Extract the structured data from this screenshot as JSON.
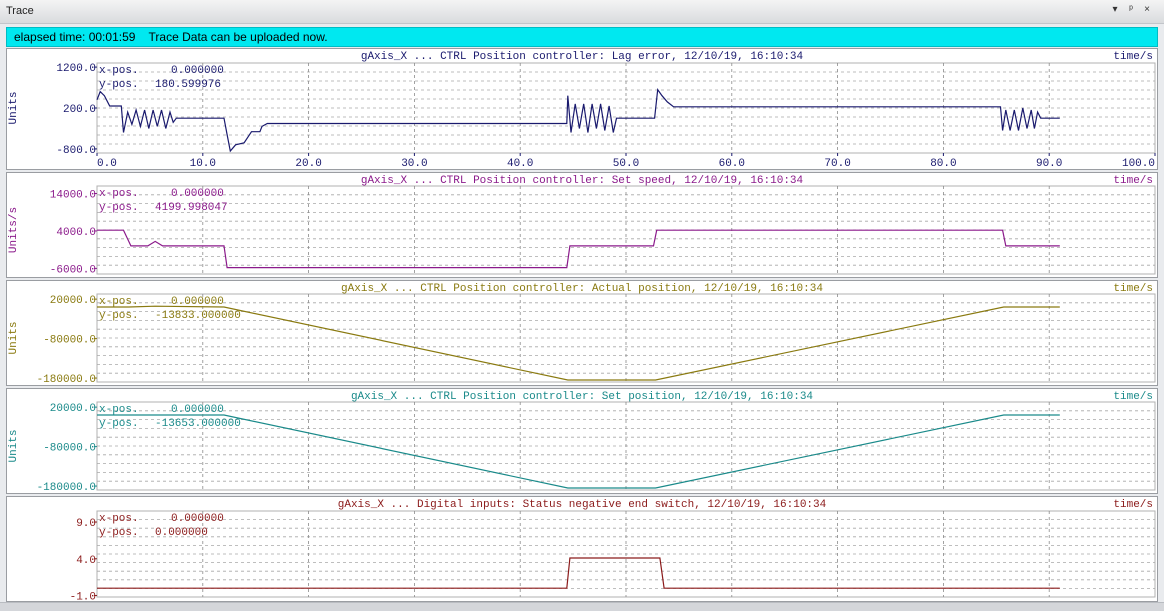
{
  "window": {
    "title": "Trace",
    "controls": {
      "menu": "▾",
      "pin": "ᵖ",
      "close": "×"
    }
  },
  "status": {
    "elapsed_label": "elapsed time: 00:01:59",
    "message": "Trace Data can be uploaded now."
  },
  "colors": {
    "status_bg": "#00e8f0",
    "grid": "#9a9a9a"
  },
  "chart_data": [
    {
      "type": "line",
      "title": "gAxis_X ... CTRL Position controller: Lag error, 12/10/19, 16:10:34",
      "unit_label": "time/s",
      "ylabel": "Units",
      "color": "#1a1a6e",
      "ylim": [
        -900,
        1300
      ],
      "yticks": [
        1200,
        200,
        -800
      ],
      "ytick_labels": [
        "1200.0",
        "200.0",
        "-800.0"
      ],
      "show_xticks": true,
      "xticks": [
        0,
        10,
        20,
        30,
        40,
        50,
        60,
        70,
        80,
        90,
        100
      ],
      "xtick_labels": [
        "0.0",
        "10.0",
        "20.0",
        "30.0",
        "40.0",
        "50.0",
        "60.0",
        "70.0",
        "80.0",
        "90.0",
        "100.0"
      ],
      "cursor": {
        "x_label": "x-pos.",
        "x_value": "0.000000",
        "y_label": "y-pos.",
        "y_value": "180.599976"
      },
      "x": [
        0,
        0.3,
        0.7,
        1.2,
        2.3,
        2.5,
        2.9,
        3.3,
        3.7,
        4.1,
        4.5,
        4.9,
        5.3,
        5.7,
        6.1,
        6.5,
        6.9,
        7.2,
        7.5,
        12,
        12.3,
        12.6,
        13.1,
        13.9,
        14.6,
        15.4,
        15.6,
        16.1,
        16.6,
        44.4,
        44.5,
        44.8,
        45.2,
        45.6,
        46,
        46.4,
        46.8,
        47.2,
        47.6,
        48,
        48.4,
        48.8,
        49.1,
        52.7,
        53,
        53.4,
        53.9,
        54.5,
        55,
        85.4,
        85.6,
        85.9,
        86.3,
        86.7,
        87.1,
        87.5,
        87.9,
        88.3,
        88.6,
        88.9,
        89.2,
        91
      ],
      "y": [
        400,
        600,
        500,
        250,
        250,
        -400,
        100,
        -200,
        150,
        -250,
        150,
        -300,
        150,
        -250,
        150,
        -300,
        100,
        -150,
        -50,
        -50,
        -450,
        -850,
        -700,
        -650,
        -380,
        -380,
        -250,
        -180,
        -180,
        -180,
        500,
        -400,
        300,
        -300,
        300,
        -400,
        300,
        -300,
        300,
        -350,
        250,
        -400,
        -50,
        -50,
        650,
        500,
        350,
        230,
        230,
        230,
        -350,
        150,
        -350,
        150,
        -350,
        200,
        -300,
        150,
        -300,
        100,
        -50,
        -50
      ]
    },
    {
      "type": "line",
      "title": "gAxis_X ... CTRL Position controller: Set speed, 12/10/19, 16:10:34",
      "unit_label": "time/s",
      "ylabel": "Units/s",
      "color": "#8b1a8b",
      "ylim": [
        -7500,
        16000
      ],
      "yticks": [
        14000,
        4000,
        -6000
      ],
      "ytick_labels": [
        "14000.0",
        "4000.0",
        "-6000.0"
      ],
      "show_xticks": false,
      "xticks": [
        0,
        10,
        20,
        30,
        40,
        50,
        60,
        70,
        80,
        90,
        100
      ],
      "cursor": {
        "x_label": "x-pos.",
        "x_value": "0.000000",
        "y_label": "y-pos.",
        "y_value": "4199.998047"
      },
      "x": [
        0,
        2.5,
        3.2,
        4.8,
        5.5,
        6.2,
        12,
        12.3,
        44.4,
        44.7,
        52.6,
        52.9,
        85.6,
        85.9,
        91
      ],
      "y": [
        4200,
        4200,
        0,
        0,
        1200,
        0,
        0,
        -5800,
        -5800,
        0,
        0,
        4200,
        4200,
        0,
        0
      ]
    },
    {
      "type": "line",
      "title": "gAxis_X ... CTRL Position controller: Actual position, 12/10/19, 16:10:34",
      "unit_label": "time/s",
      "ylabel": "Units",
      "color": "#8a7a10",
      "ylim": [
        -190000,
        33000
      ],
      "yticks": [
        20000,
        -80000,
        -180000
      ],
      "ytick_labels": [
        "20000.0",
        "-80000.0",
        "-180000.0"
      ],
      "show_xticks": false,
      "xticks": [
        0,
        10,
        20,
        30,
        40,
        50,
        60,
        70,
        80,
        90,
        100
      ],
      "cursor": {
        "x_label": "x-pos.",
        "x_value": "0.000000",
        "y_label": "y-pos.",
        "y_value": "-13833.000000"
      },
      "x": [
        0,
        3,
        5.5,
        12,
        44.5,
        52.8,
        85.7,
        91
      ],
      "y": [
        0,
        0,
        2000,
        0,
        -185000,
        -185000,
        0,
        0
      ]
    },
    {
      "type": "line",
      "title": "gAxis_X ... CTRL Position controller: Set position, 12/10/19, 16:10:34",
      "unit_label": "time/s",
      "ylabel": "Units",
      "color": "#1a8a8a",
      "ylim": [
        -190000,
        33000
      ],
      "yticks": [
        20000,
        -80000,
        -180000
      ],
      "ytick_labels": [
        "20000.0",
        "-80000.0",
        "-180000.0"
      ],
      "show_xticks": false,
      "xticks": [
        0,
        10,
        20,
        30,
        40,
        50,
        60,
        70,
        80,
        90,
        100
      ],
      "cursor": {
        "x_label": "x-pos.",
        "x_value": "0.000000",
        "y_label": "y-pos.",
        "y_value": "-13653.000000"
      },
      "x": [
        0,
        12,
        44.5,
        52.8,
        85.7,
        91
      ],
      "y": [
        0,
        0,
        -185000,
        -185000,
        0,
        0
      ]
    },
    {
      "type": "line",
      "title": "gAxis_X ... Digital inputs: Status negative end switch, 12/10/19, 16:10:34",
      "unit_label": "time/s",
      "ylabel": "",
      "color": "#8b1a1a",
      "ylim": [
        -1.2,
        10.5
      ],
      "yticks": [
        9,
        4,
        -1
      ],
      "ytick_labels": [
        "9.0",
        "4.0",
        "-1.0"
      ],
      "show_xticks": false,
      "xticks": [
        0,
        10,
        20,
        30,
        40,
        50,
        60,
        70,
        80,
        90,
        100
      ],
      "cursor": {
        "x_label": "x-pos.",
        "x_value": "0.000000",
        "y_label": "y-pos.",
        "y_value": "0.000000"
      },
      "x": [
        0,
        44.4,
        44.7,
        53.2,
        53.6,
        91
      ],
      "y": [
        0,
        0,
        4.1,
        4.1,
        0,
        0
      ]
    }
  ]
}
